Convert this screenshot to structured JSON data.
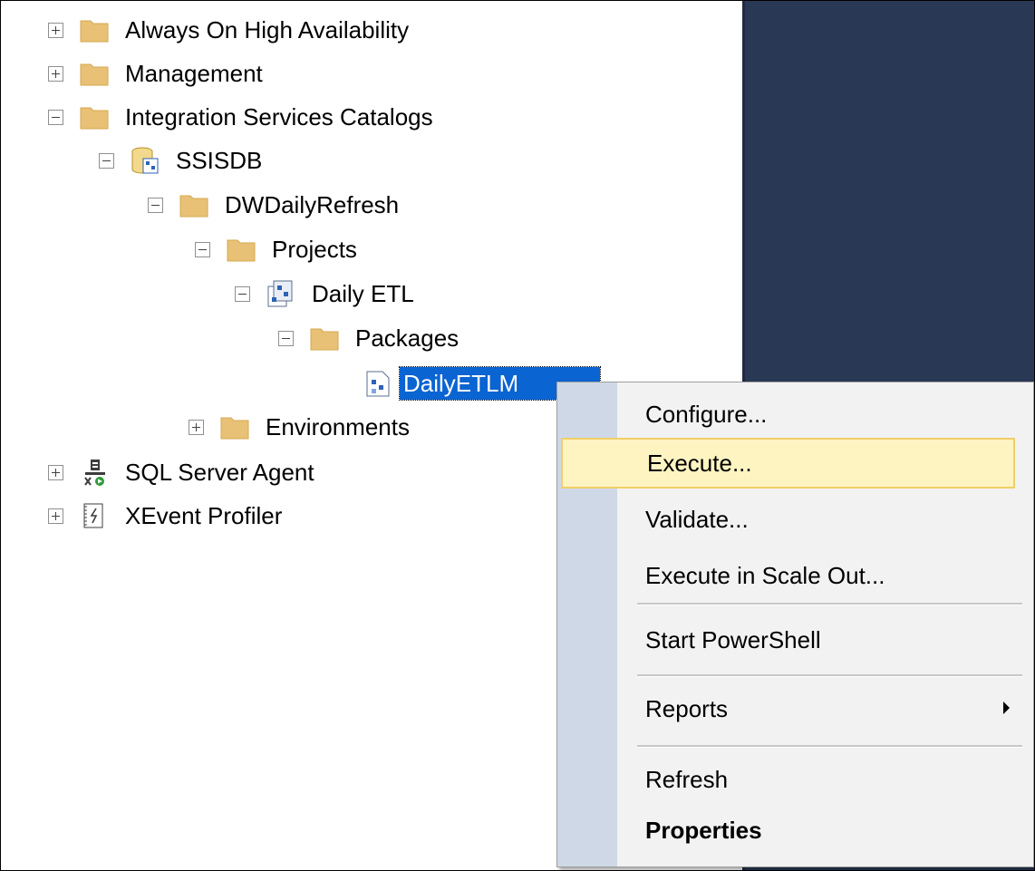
{
  "tree": {
    "always_on": "Always On High Availability",
    "management": "Management",
    "isc": "Integration Services Catalogs",
    "ssisdb": "SSISDB",
    "folder": "DWDailyRefresh",
    "projects": "Projects",
    "project": "Daily ETL",
    "packages": "Packages",
    "package": "DailyETLM",
    "environments": "Environments",
    "agent": "SQL Server Agent",
    "xevent": "XEvent Profiler"
  },
  "context_menu": {
    "configure": "Configure...",
    "execute": "Execute...",
    "validate": "Validate...",
    "execute_scale_out": "Execute in Scale Out...",
    "start_powershell": "Start PowerShell",
    "reports": "Reports",
    "refresh": "Refresh",
    "properties": "Properties",
    "hover_item": "Execute..."
  },
  "colors": {
    "selection": "#0a64d2",
    "hover_fill": "#fef4c1",
    "hover_border": "#f0cf6a",
    "right_pane": "#293955",
    "folder": "#e8c176"
  }
}
